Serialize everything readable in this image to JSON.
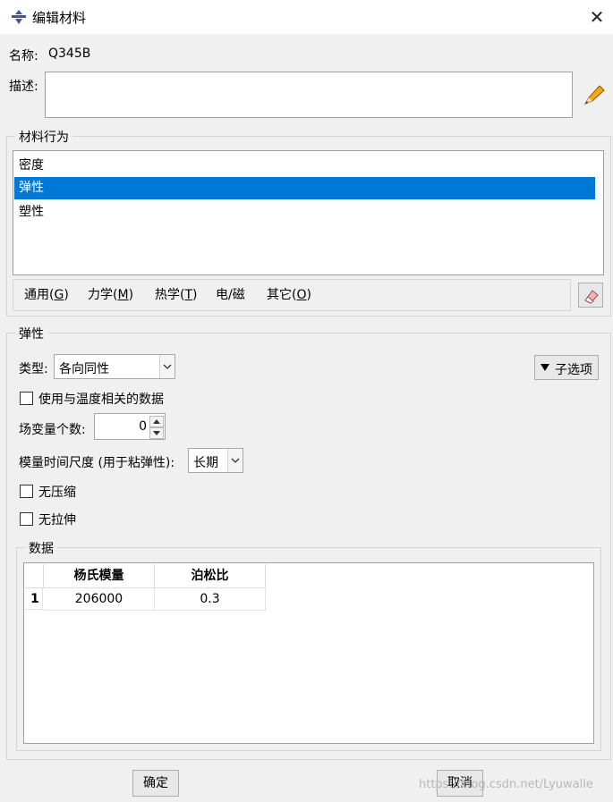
{
  "window": {
    "title": "编辑材料",
    "close_glyph": "✕"
  },
  "name_row": {
    "label": "名称:",
    "value": "Q345B"
  },
  "description": {
    "label": "描述:",
    "value": "",
    "edit_icon": "pencil-icon"
  },
  "behavior": {
    "group_title": "材料行为",
    "items": [
      "密度",
      "弹性",
      "塑性"
    ],
    "selected_index": 1
  },
  "menu": {
    "items": [
      {
        "label": "通用(",
        "key": "G",
        "suffix": ")"
      },
      {
        "label": "力学(",
        "key": "M",
        "suffix": ")"
      },
      {
        "label": "热学(",
        "key": "T",
        "suffix": ")"
      },
      {
        "label": "电/磁",
        "key": "",
        "suffix": ""
      },
      {
        "label": "其它(",
        "key": "O",
        "suffix": ")"
      }
    ],
    "eraser_icon": "eraser-icon"
  },
  "elastic": {
    "group_title": "弹性",
    "type_label": "类型:",
    "type_value": "各向同性",
    "suboptions_label": "子选项",
    "temp_dependent_label": "使用与温度相关的数据",
    "temp_dependent_checked": false,
    "field_vars_label": "场变量个数:",
    "field_vars_value": "0",
    "moduli_label": "模量时间尺度 (用于粘弹性):",
    "moduli_value": "长期",
    "no_compression_label": "无压缩",
    "no_compression_checked": false,
    "no_tension_label": "无拉伸",
    "no_tension_checked": false
  },
  "data_table": {
    "group_title": "数据",
    "columns": [
      "杨氏模量",
      "泊松比"
    ],
    "rows": [
      {
        "index": "1",
        "cells": [
          "206000",
          "0.3"
        ]
      }
    ]
  },
  "buttons": {
    "ok": "确定",
    "cancel": "取消"
  },
  "watermark": "https://blog.csdn.net/Lyuwalle",
  "colors": {
    "selection": "#0078d7"
  }
}
